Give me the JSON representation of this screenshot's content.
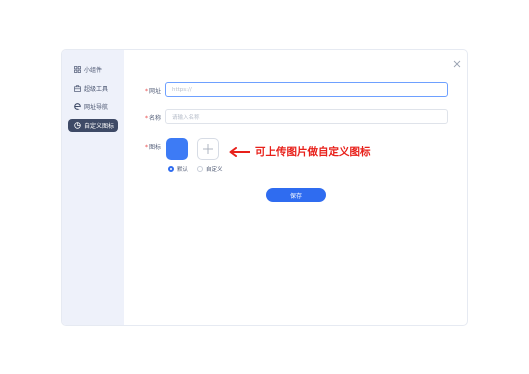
{
  "sidebar": {
    "items": [
      {
        "label": "小组件",
        "icon": "grid-icon",
        "active": false
      },
      {
        "label": "超级工具",
        "icon": "toolbox-icon",
        "active": false
      },
      {
        "label": "网址导航",
        "icon": "browser-e-icon",
        "active": false
      },
      {
        "label": "自定义图标",
        "icon": "custom-icon",
        "active": true
      }
    ]
  },
  "form": {
    "url_label": "网址",
    "url_value": "https://",
    "name_label": "名称",
    "name_placeholder": "请输入名称",
    "icon_label": "图标",
    "radio_default": "默认",
    "radio_custom": "自定义",
    "save_label": "保存",
    "required_mark": "*"
  },
  "annotation": {
    "text": "可上传图片做自定义图标"
  },
  "colors": {
    "accent": "#2f6cf0",
    "icon_swatch": "#3d7bf5",
    "sidebar_bg": "#eef1fa",
    "sidebar_active": "#3e4a66",
    "annotation": "#e8201a",
    "required": "#e84a4a"
  }
}
